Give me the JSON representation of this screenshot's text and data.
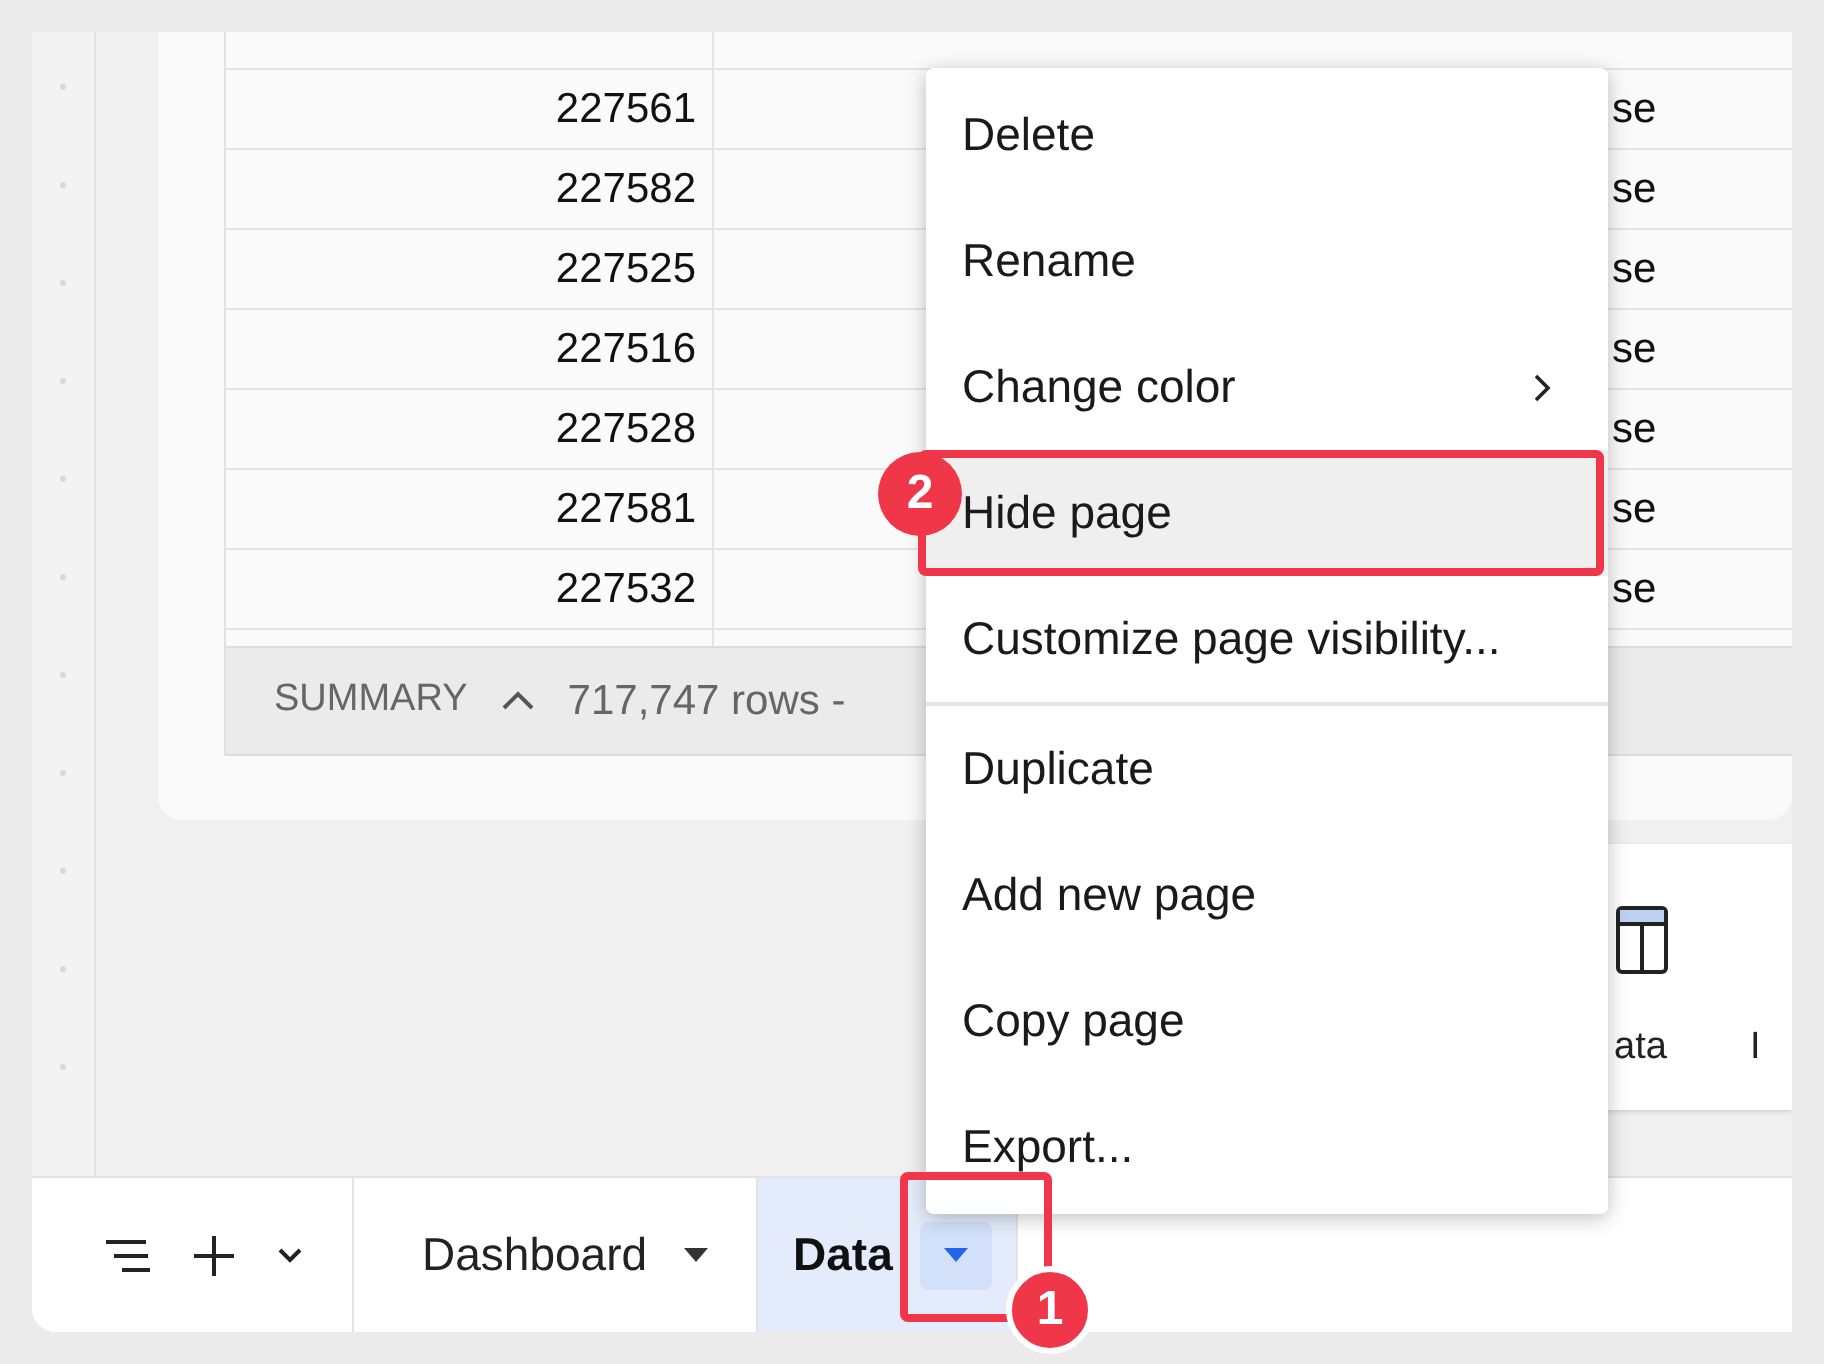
{
  "table": {
    "rows": [
      {
        "cells": [
          "227561",
          "se"
        ]
      },
      {
        "cells": [
          "227582",
          "se"
        ]
      },
      {
        "cells": [
          "227525",
          "se"
        ]
      },
      {
        "cells": [
          "227516",
          "se"
        ]
      },
      {
        "cells": [
          "227528",
          "se"
        ]
      },
      {
        "cells": [
          "227581",
          "se"
        ]
      },
      {
        "cells": [
          "227532",
          "se"
        ]
      }
    ],
    "summary": {
      "label": "SUMMARY",
      "expanded": false,
      "count": "717,747 rows -"
    }
  },
  "element_panel": {
    "items": [
      {
        "label": "ata",
        "kind": "table"
      },
      {
        "label": "I",
        "kind": "text"
      }
    ]
  },
  "context_menu": {
    "items": [
      {
        "kind": "item",
        "label": "Delete",
        "selected": false
      },
      {
        "kind": "item",
        "label": "Rename",
        "selected": false
      },
      {
        "kind": "submenu",
        "label": "Change color",
        "selected": false
      },
      {
        "kind": "item",
        "label": "Hide page",
        "selected": true
      },
      {
        "kind": "item",
        "label": "Customize page visibility...",
        "selected": false
      },
      {
        "kind": "divider"
      },
      {
        "kind": "item",
        "label": "Duplicate",
        "selected": false
      },
      {
        "kind": "item",
        "label": "Add new page",
        "selected": false
      },
      {
        "kind": "item",
        "label": "Copy page",
        "selected": false
      },
      {
        "kind": "item",
        "label": "Export...",
        "selected": false
      }
    ]
  },
  "page_tabs": [
    {
      "label": "Dashboard",
      "selected": false
    },
    {
      "label": "Data",
      "selected": true
    }
  ],
  "callouts": [
    {
      "label": "1"
    },
    {
      "label": "2"
    }
  ]
}
